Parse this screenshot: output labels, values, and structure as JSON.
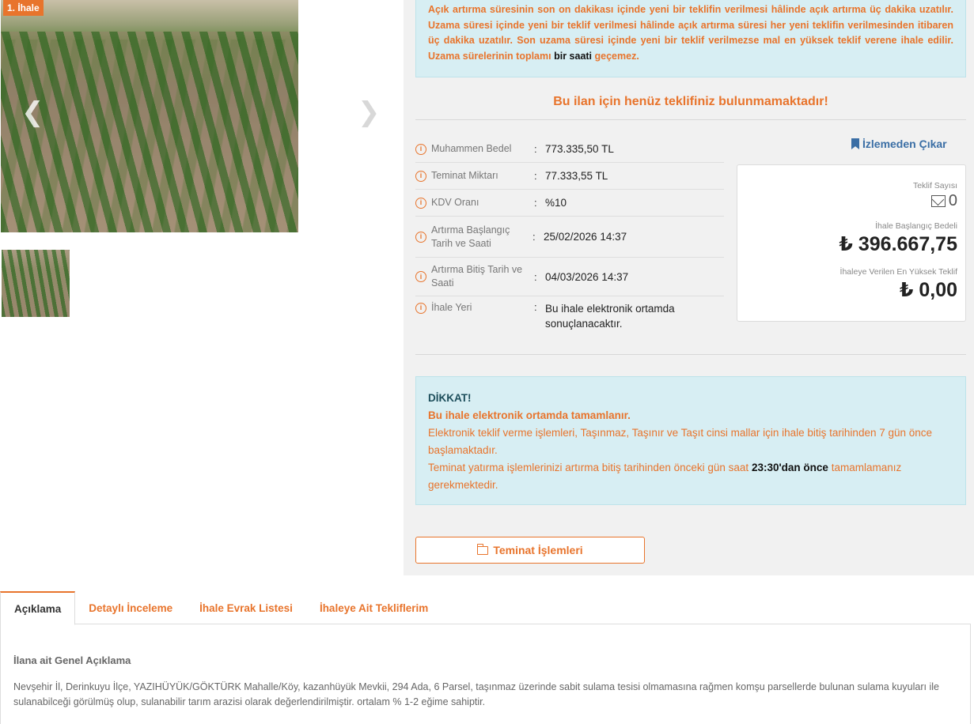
{
  "gallery": {
    "badge": "1. İhale",
    "prev_icon": "chevron-left-icon",
    "next_icon": "chevron-right-icon"
  },
  "info_box": {
    "text_part1": "Açık artırma süresinin son on dakikası içinde yeni bir teklifin verilmesi hâlinde açık artırma üç dakika uzatılır. Uzama süresi içinde yeni bir teklif verilmesi hâlinde açık artırma süresi her yeni teklifin verilmesinden itibaren üç dakika uzatılır. Son uzama süresi içinde yeni bir teklif verilmezse mal en yüksek teklif verene ihale edilir. Uzama sürelerinin toplamı",
    "text_bold": "bir saati",
    "text_part2": "geçemez."
  },
  "no_bid_message": "Bu ilan için henüz teklifiniz bulunmamaktadır!",
  "details": [
    {
      "label": "Muhammen Bedel",
      "value": "773.335,50 TL"
    },
    {
      "label": "Teminat Miktarı",
      "value": "77.333,55 TL"
    },
    {
      "label": "KDV Oranı",
      "value": "%10"
    },
    {
      "label": "Artırma Başlangıç Tarih ve Saati",
      "value": "25/02/2026 14:37"
    },
    {
      "label": "Artırma Bitiş Tarih ve Saati",
      "value": "04/03/2026 14:37"
    },
    {
      "label": "İhale Yeri",
      "value": "Bu ihale elektronik ortamda sonuçlanacaktır."
    }
  ],
  "watch": {
    "label": "İzlemeden Çıkar",
    "icon": "bookmark-icon"
  },
  "bid_card": {
    "count_label": "Teklif Sayısı",
    "count_value": "0",
    "start_label": "İhale Başlangıç Bedeli",
    "start_value": "₺ 396.667,75",
    "highest_label": "İhaleye Verilen En Yüksek Teklif",
    "highest_value": "₺ 0,00"
  },
  "warning": {
    "title": "DİKKAT!",
    "subtitle": "Bu ihale elektronik ortamda tamamlanır.",
    "line1": "Elektronik teklif verme işlemleri, Taşınmaz, Taşınır ve Taşıt cinsi mallar için ihale bitiş tarihinden 7 gün önce başlamaktadır.",
    "line2_a": "Teminat yatırma işlemlerinizi artırma bitiş tarihinden önceki gün saat",
    "line2_bold": "23:30'dan önce",
    "line2_b": "tamamlamanız gerekmektedir."
  },
  "teminat_button": "Teminat İşlemleri",
  "tabs": [
    {
      "label": "Açıklama",
      "active": true
    },
    {
      "label": "Detaylı İnceleme",
      "active": false
    },
    {
      "label": "İhale Evrak Listesi",
      "active": false
    },
    {
      "label": "İhaleye Ait Tekliflerim",
      "active": false
    }
  ],
  "description": {
    "heading": "İlana ait Genel Açıklama",
    "text": "Nevşehir İl, Derinkuyu İlçe, YAZIHÜYÜK/GÖKTÜRK Mahalle/Köy, kazanhüyük Mevkii, 294 Ada, 6 Parsel, taşınmaz üzerinde sabit sulama tesisi olmamasına rağmen komşu parsellerde bulunan sulama kuyuları ile sulanabilceği görülmüş olup, sulanabilir tarım arazisi olarak değerlendirilmiştir. ortalam % 1-2 eğime sahiptir."
  },
  "colors": {
    "accent": "#e8742c",
    "info_bg": "#d7eef3",
    "link": "#3a6ea5"
  }
}
